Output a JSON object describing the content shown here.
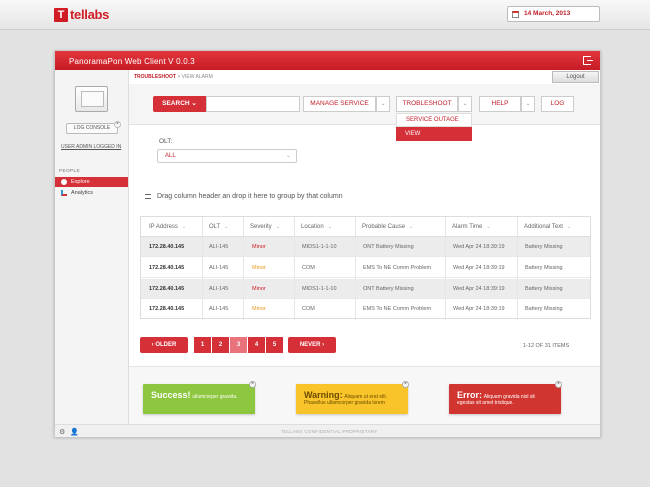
{
  "brand": {
    "logo_letter": "T",
    "name": "tellabs"
  },
  "date": "14 March, 2013",
  "window": {
    "title": "PanoramaPon Web Client V 0.0.3",
    "logout": "Logout"
  },
  "breadcrumb": {
    "current": "TROUBLESHOOT",
    "sep": ">",
    "rest": "VIEW ALARM"
  },
  "sidebar": {
    "log_console": "LOG CONSOLE",
    "close": "×",
    "user_info": "USER ADMIN LOGGED IN",
    "section": "PEOPLE",
    "items": [
      {
        "label": "Explore"
      },
      {
        "label": "Analytics"
      }
    ]
  },
  "toolbar": {
    "search": "SEARCH ⌄",
    "manage": "MANAGE SERVICE",
    "trouble": "TROBLESHOOT",
    "help": "HELP",
    "log": "LOG",
    "caret": "⌄",
    "dropdown": [
      "SERVICE OUTAGE",
      "VIEW"
    ]
  },
  "olt": {
    "label": "OLT:",
    "value": "ALL",
    "caret": "⌄"
  },
  "group_hint": "Drag column header an drop it here to group by that column",
  "grid": {
    "caret": "⌄",
    "columns": [
      "IP Address",
      "OLT",
      "Severity",
      "Location",
      "Probable Cause",
      "Alarm Time",
      "Additional Text"
    ],
    "rows": [
      [
        "172.28.40.145",
        "ALI-145",
        "Minor",
        "MIDS1-1-1-10",
        "ONT Battery Missing",
        "Wed Apr 24 18:39:19",
        "Battery Missing"
      ],
      [
        "172.28.40.145",
        "ALI-145",
        "Minor",
        "COM",
        "EMS To NE Comm Problem",
        "Wed Apr 24 18:39:19",
        "Battery Missing"
      ],
      [
        "172.28.40.145",
        "ALI-145",
        "Minor",
        "MIDS1-1-1-10",
        "ONT Battery Missing",
        "Wed Apr 24 18:39:19",
        "Battery Missing"
      ],
      [
        "172.28.40.145",
        "ALI-145",
        "Minor",
        "COM",
        "EMS To NE Comm Problem",
        "Wed Apr 24 18:39:19",
        "Battery Missing"
      ]
    ],
    "severity_colors": [
      "#d0202a",
      "#e8961a",
      "#d0202a",
      "#e8961a"
    ]
  },
  "pager": {
    "older": "‹ OLDER",
    "pages": [
      "1",
      "2",
      "3",
      "4",
      "5"
    ],
    "active_page": "3",
    "never": "NEVER ›",
    "count": "1-12 OF 31 ITEMS"
  },
  "notifications": {
    "success": {
      "title": "Success!",
      "text": "ullamcorper gravida."
    },
    "warning": {
      "title": "Warning:",
      "text": "Aliquam ut erat elit. Phasellus ullamcorper gravida lorem"
    },
    "error": {
      "title": "Error:",
      "text": "Aliquam gravida nisl sit egestas sit amet tristique."
    },
    "close": "×"
  },
  "footer": {
    "text": "TELLABS CONFIDENTIAL PROPRIETARY",
    "gear": "⚙",
    "user": "👤"
  },
  "colors": {
    "accent": "#d53038",
    "success": "#8dc63f",
    "warning": "#f8c42a",
    "error": "#d0352f"
  }
}
